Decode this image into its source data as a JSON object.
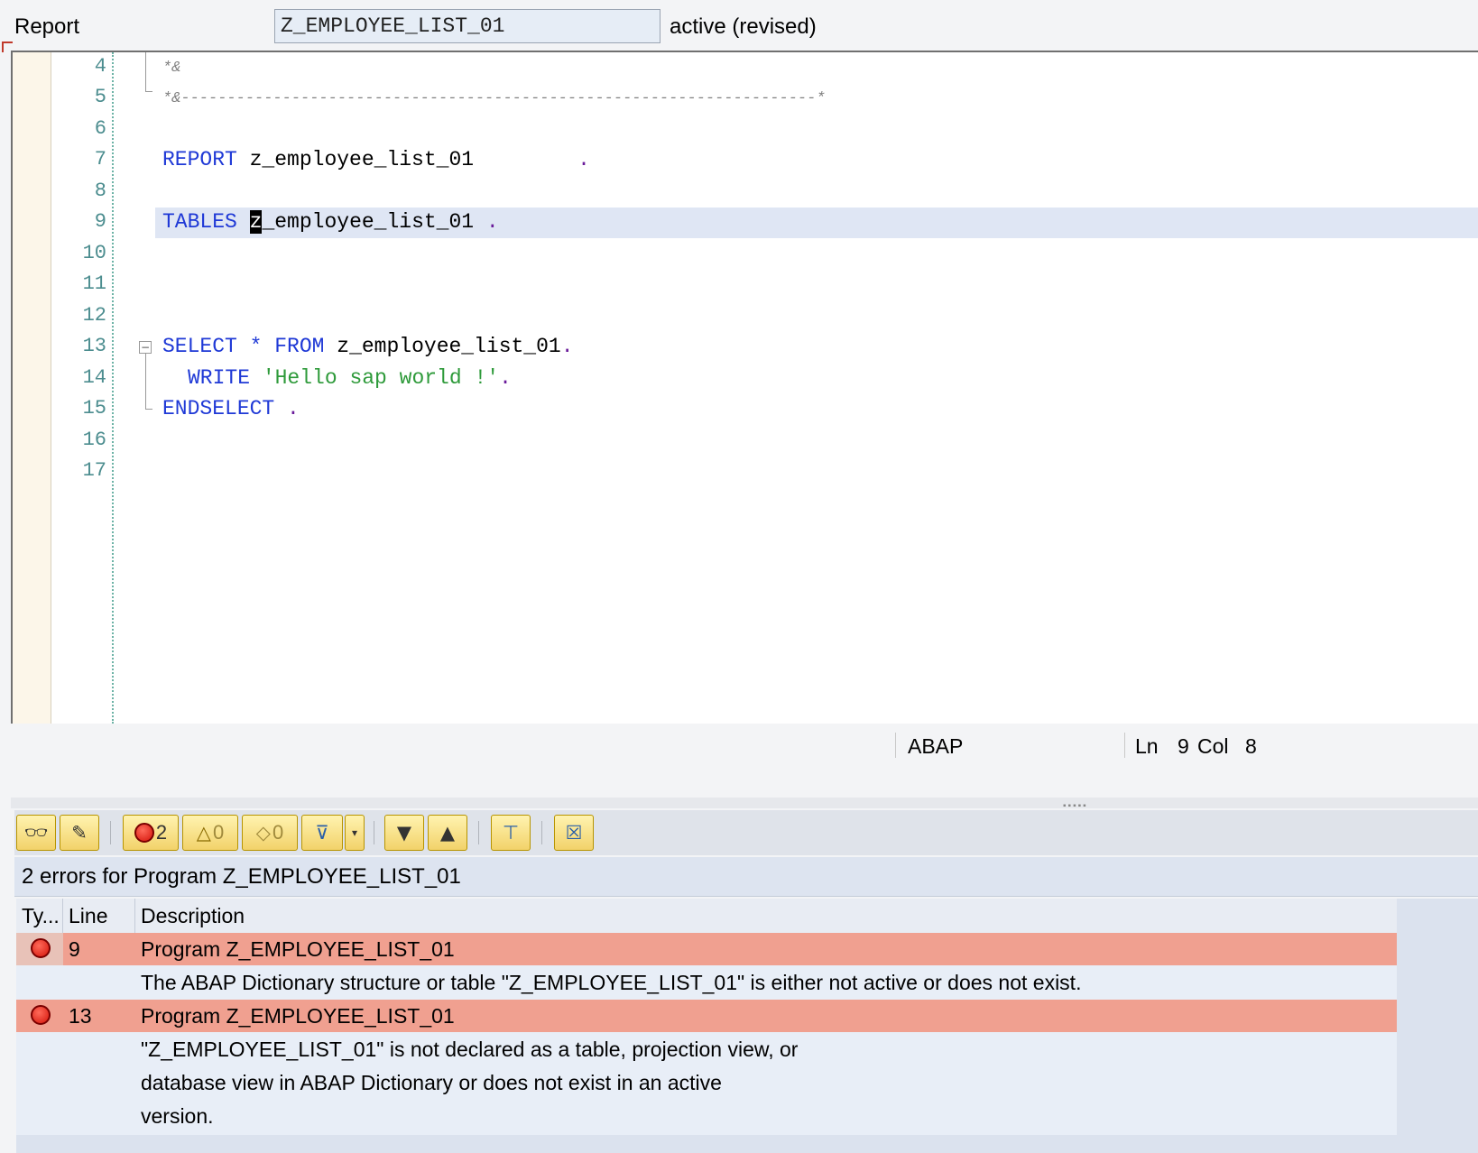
{
  "header": {
    "object_type_label": "Report",
    "program_name": "Z_EMPLOYEE_LIST_01",
    "status": "active (revised)"
  },
  "editor": {
    "lines": [
      {
        "no": "4",
        "text": "*&"
      },
      {
        "no": "5",
        "text": "*&---------------------------------------------------------------------*"
      },
      {
        "no": "6",
        "text": ""
      },
      {
        "no": "7",
        "kw": "REPORT",
        "rest": " z_employee_list_01",
        "dot": "."
      },
      {
        "no": "8",
        "text": ""
      },
      {
        "no": "9",
        "kw": "TABLES",
        "cursor_char": "z",
        "rest": "_employee_list_01 ",
        "dot": "."
      },
      {
        "no": "10",
        "text": ""
      },
      {
        "no": "11",
        "text": ""
      },
      {
        "no": "12",
        "text": ""
      },
      {
        "no": "13",
        "kw": "SELECT",
        "star": " * ",
        "kw2": "FROM",
        "rest": " z_employee_list_01",
        "dot": "."
      },
      {
        "no": "14",
        "kw": "WRITE",
        "str": "'Hello sap world !'",
        "dot": "."
      },
      {
        "no": "15",
        "kw": "ENDSELECT",
        "dot": "."
      },
      {
        "no": "16",
        "text": ""
      },
      {
        "no": "17",
        "text": ""
      }
    ],
    "current_line": "9"
  },
  "statusbar": {
    "language": "ABAP",
    "ln_label": "Ln",
    "ln_value": "9",
    "col_label": "Col",
    "col_value": "8"
  },
  "toolbar": {
    "error_count": "2",
    "warning_count": "0",
    "info_count": "0",
    "icons": [
      "glasses-icon",
      "pencil-icon",
      "error-filter-icon",
      "warning-filter-icon",
      "info-filter-icon",
      "filter-icon",
      "next-icon",
      "previous-icon",
      "pin-icon",
      "close-icon"
    ]
  },
  "messages": {
    "title": "2 errors for Program Z_EMPLOYEE_LIST_01",
    "columns": [
      "Ty...",
      "Line",
      "Description"
    ],
    "rows": [
      {
        "type": "error",
        "line": "9",
        "title": "Program Z_EMPLOYEE_LIST_01",
        "desc": [
          "The ABAP Dictionary structure or table \"Z_EMPLOYEE_LIST_01\" is either not active or does not exist."
        ]
      },
      {
        "type": "error",
        "line": "13",
        "title": "Program Z_EMPLOYEE_LIST_01",
        "desc": [
          "\"Z_EMPLOYEE_LIST_01\" is not declared as a table, projection view, or",
          "database view in ABAP Dictionary or does not exist in an active",
          "version."
        ]
      }
    ]
  },
  "colors": {
    "keyword": "#1f39d6",
    "string": "#2e9a3a",
    "error_row": "#f0a090",
    "line_number": "#4c8d8f"
  }
}
